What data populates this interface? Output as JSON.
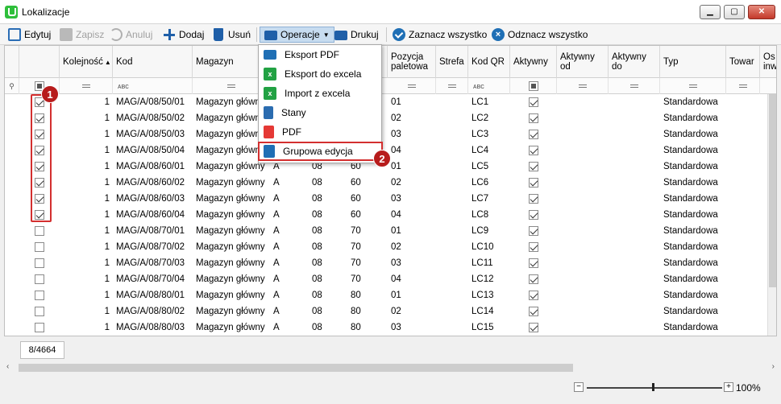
{
  "window": {
    "title": "Lokalizacje"
  },
  "toolbar": {
    "edit": "Edytuj",
    "save": "Zapisz",
    "cancel": "Anuluj",
    "add": "Dodaj",
    "delete": "Usuń",
    "operations": "Operacje",
    "print": "Drukuj",
    "select_all": "Zaznacz wszystko",
    "deselect_all": "Odznacz wszystko"
  },
  "columns": [
    "Kolejność",
    "Kod",
    "Magazyn",
    "Pozycja paletowa",
    "Strefa",
    "Kod QR",
    "Aktywny",
    "Aktywny od",
    "Aktywny do",
    "Typ",
    "Towar",
    "Os inw"
  ],
  "rows": [
    {
      "checked": true,
      "order": "1",
      "code": "MAG/A/08/50/01",
      "warehouse": "Magazyn główny",
      "c1": "",
      "c2": "",
      "c3": "",
      "pallet": "01",
      "qr": "LC1",
      "type": "Standardowa"
    },
    {
      "checked": true,
      "order": "1",
      "code": "MAG/A/08/50/02",
      "warehouse": "Magazyn główny",
      "c1": "",
      "c2": "",
      "c3": "",
      "pallet": "02",
      "qr": "LC2",
      "type": "Standardowa"
    },
    {
      "checked": true,
      "order": "1",
      "code": "MAG/A/08/50/03",
      "warehouse": "Magazyn główny",
      "c1": "",
      "c2": "",
      "c3": "",
      "pallet": "03",
      "qr": "LC3",
      "type": "Standardowa"
    },
    {
      "checked": true,
      "order": "1",
      "code": "MAG/A/08/50/04",
      "warehouse": "Magazyn główny",
      "c1": "",
      "c2": "",
      "c3": "",
      "pallet": "04",
      "qr": "LC4",
      "type": "Standardowa"
    },
    {
      "checked": true,
      "order": "1",
      "code": "MAG/A/08/60/01",
      "warehouse": "Magazyn główny",
      "c1": "A",
      "c2": "08",
      "c3": "60",
      "pallet": "01",
      "qr": "LC5",
      "type": "Standardowa"
    },
    {
      "checked": true,
      "order": "1",
      "code": "MAG/A/08/60/02",
      "warehouse": "Magazyn główny",
      "c1": "A",
      "c2": "08",
      "c3": "60",
      "pallet": "02",
      "qr": "LC6",
      "type": "Standardowa"
    },
    {
      "checked": true,
      "order": "1",
      "code": "MAG/A/08/60/03",
      "warehouse": "Magazyn główny",
      "c1": "A",
      "c2": "08",
      "c3": "60",
      "pallet": "03",
      "qr": "LC7",
      "type": "Standardowa"
    },
    {
      "checked": true,
      "order": "1",
      "code": "MAG/A/08/60/04",
      "warehouse": "Magazyn główny",
      "c1": "A",
      "c2": "08",
      "c3": "60",
      "pallet": "04",
      "qr": "LC8",
      "type": "Standardowa"
    },
    {
      "checked": false,
      "order": "1",
      "code": "MAG/A/08/70/01",
      "warehouse": "Magazyn główny",
      "c1": "A",
      "c2": "08",
      "c3": "70",
      "pallet": "01",
      "qr": "LC9",
      "type": "Standardowa"
    },
    {
      "checked": false,
      "order": "1",
      "code": "MAG/A/08/70/02",
      "warehouse": "Magazyn główny",
      "c1": "A",
      "c2": "08",
      "c3": "70",
      "pallet": "02",
      "qr": "LC10",
      "type": "Standardowa"
    },
    {
      "checked": false,
      "order": "1",
      "code": "MAG/A/08/70/03",
      "warehouse": "Magazyn główny",
      "c1": "A",
      "c2": "08",
      "c3": "70",
      "pallet": "03",
      "qr": "LC11",
      "type": "Standardowa"
    },
    {
      "checked": false,
      "order": "1",
      "code": "MAG/A/08/70/04",
      "warehouse": "Magazyn główny",
      "c1": "A",
      "c2": "08",
      "c3": "70",
      "pallet": "04",
      "qr": "LC12",
      "type": "Standardowa"
    },
    {
      "checked": false,
      "order": "1",
      "code": "MAG/A/08/80/01",
      "warehouse": "Magazyn główny",
      "c1": "A",
      "c2": "08",
      "c3": "80",
      "pallet": "01",
      "qr": "LC13",
      "type": "Standardowa"
    },
    {
      "checked": false,
      "order": "1",
      "code": "MAG/A/08/80/02",
      "warehouse": "Magazyn główny",
      "c1": "A",
      "c2": "08",
      "c3": "80",
      "pallet": "02",
      "qr": "LC14",
      "type": "Standardowa"
    },
    {
      "checked": false,
      "order": "1",
      "code": "MAG/A/08/80/03",
      "warehouse": "Magazyn główny",
      "c1": "A",
      "c2": "08",
      "c3": "80",
      "pallet": "03",
      "qr": "LC15",
      "type": "Standardowa"
    }
  ],
  "menu": [
    "Eksport PDF",
    "Eksport do excela",
    "Import z excela",
    "Stany",
    "PDF",
    "Grupowa edycja"
  ],
  "badges": {
    "first": "1",
    "second": "2"
  },
  "footer": {
    "counter": "8/4664",
    "zoom": "100%",
    "zoom_minus": "−",
    "zoom_plus": "+"
  },
  "colors": {
    "highlight": "#d32f2f",
    "badge": "#b71c1c",
    "accent": "#1f6fb5"
  }
}
